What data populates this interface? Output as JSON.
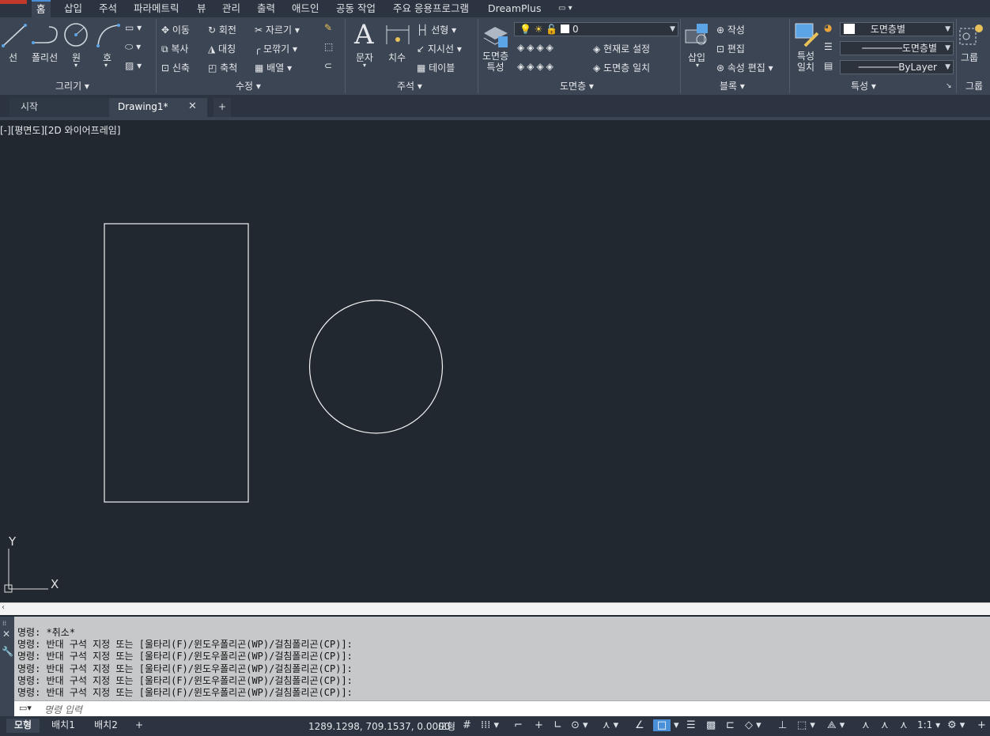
{
  "menu": {
    "items": [
      "홈",
      "삽입",
      "주석",
      "파라메트릭",
      "뷰",
      "관리",
      "출력",
      "애드인",
      "공동 작업",
      "주요 응용프로그램",
      "DreamPlus"
    ]
  },
  "ribbon": {
    "draw": {
      "panel": "그리기 ▾",
      "line": "선",
      "polyline": "폴리선",
      "circle": "원",
      "arc": "호"
    },
    "modify": {
      "panel": "수정 ▾",
      "move": "이동",
      "rotate": "회전",
      "trim": "자르기",
      "copy": "복사",
      "mirror": "대칭",
      "fillet": "모깎기",
      "stretch": "신축",
      "scale": "축척",
      "array": "배열"
    },
    "annotation": {
      "panel": "주석 ▾",
      "text": "문자",
      "dimension": "치수",
      "linear": "선형",
      "leader": "지시선",
      "table": "테이블"
    },
    "layers": {
      "panel": "도면층 ▾",
      "props_line1": "도면층",
      "props_line2": "특성",
      "current_layer": "0",
      "make_current": "현재로 설정",
      "match_layer": "도면층 일치"
    },
    "block": {
      "panel": "블록 ▾",
      "insert": "삽입",
      "create": "작성",
      "edit": "편집",
      "edit_attr": "속성 편집"
    },
    "properties": {
      "panel": "특성 ▾",
      "match_line1": "특성",
      "match_line2": "일치",
      "color": "도면층별",
      "linetype": "도면층별",
      "lineweight": "ByLayer"
    },
    "groups": {
      "panel": "그룹",
      "group": "그룹"
    }
  },
  "tabs": {
    "start": "시작",
    "drawing": "Drawing1*",
    "close": "✕",
    "new": "+"
  },
  "viewport": {
    "label": "[-][평면도][2D 와이어프레임]",
    "ucs_x": "X",
    "ucs_y": "Y"
  },
  "command": {
    "lines": [
      "명령: *취소*",
      "명령: 반대 구석 지정 또는 [울타리(F)/윈도우폴리곤(WP)/걸침폴리곤(CP)]:",
      "명령: 반대 구석 지정 또는 [울타리(F)/윈도우폴리곤(WP)/걸침폴리곤(CP)]:",
      "명령: 반대 구석 지정 또는 [울타리(F)/윈도우폴리곤(WP)/걸침폴리곤(CP)]:",
      "명령: 반대 구석 지정 또는 [울타리(F)/윈도우폴리곤(WP)/걸침폴리곤(CP)]:",
      "명령: 반대 구석 지정 또는 [울타리(F)/윈도우폴리곤(WP)/걸침폴리곤(CP)]:"
    ],
    "placeholder": "명령 입력"
  },
  "status": {
    "model_tab": "모형",
    "layout1": "배치1",
    "layout2": "배치2",
    "add": "+",
    "coords": "1289.1298, 709.1537, 0.0000",
    "model_btn": "모형",
    "scale": "1:1"
  },
  "colors": {
    "canvas": "#212830",
    "ribbon": "#3b4553",
    "accent": "#4a90d9"
  }
}
